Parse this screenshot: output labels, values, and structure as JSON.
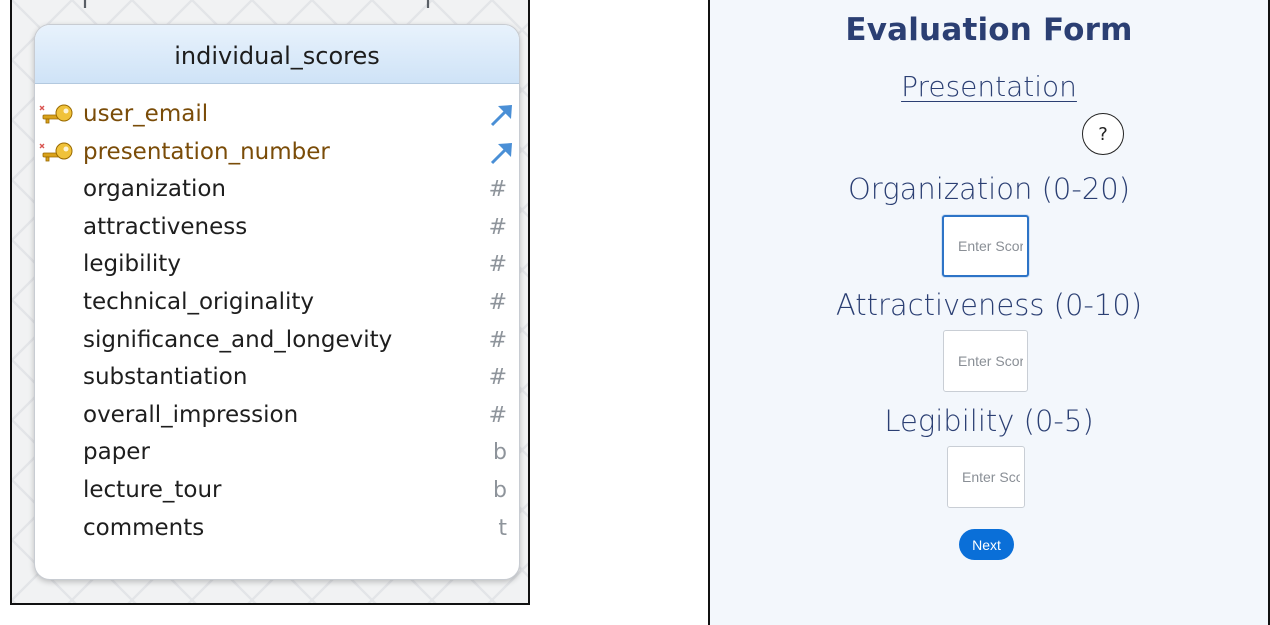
{
  "er_diagram": {
    "table_name": "individual_scores",
    "columns": [
      {
        "name": "user_email",
        "primary_key": true,
        "type_icon": "foreign-key-arrow-icon"
      },
      {
        "name": "presentation_number",
        "primary_key": true,
        "type_icon": "foreign-key-arrow-icon"
      },
      {
        "name": "organization",
        "type_marker": "#"
      },
      {
        "name": "attractiveness",
        "type_marker": "#"
      },
      {
        "name": "legibility",
        "type_marker": "#"
      },
      {
        "name": "technical_originality",
        "type_marker": "#"
      },
      {
        "name": "significance_and_longevity",
        "type_marker": "#"
      },
      {
        "name": "substantiation",
        "type_marker": "#"
      },
      {
        "name": "overall_impression",
        "type_marker": "#"
      },
      {
        "name": "paper",
        "type_marker": "b"
      },
      {
        "name": "lecture_tour",
        "type_marker": "b"
      },
      {
        "name": "comments",
        "type_marker": "t"
      }
    ],
    "icons": {
      "primary_key": "key-icon",
      "relation": "relationship-arrow-icon"
    },
    "colors": {
      "header": "#d6e8f8",
      "pk_text": "#7a4c08",
      "fk_arrow": "#4a8fd6"
    }
  },
  "form": {
    "title": "Evaluation Form",
    "subtitle": "Presentation",
    "help_label": "?",
    "fields": [
      {
        "label": "Organization (0-20)",
        "placeholder": "Enter Score",
        "value": ""
      },
      {
        "label": "Attractiveness (0-10)",
        "placeholder": "Enter Score",
        "value": ""
      },
      {
        "label": "Legibility (0-5)",
        "placeholder": "Enter Score",
        "value": ""
      }
    ],
    "next_label": "Next",
    "colors": {
      "heading": "#2b3f73",
      "button": "#0a6fd8",
      "focus": "#2d74c7",
      "background": "#f3f7fc"
    }
  }
}
